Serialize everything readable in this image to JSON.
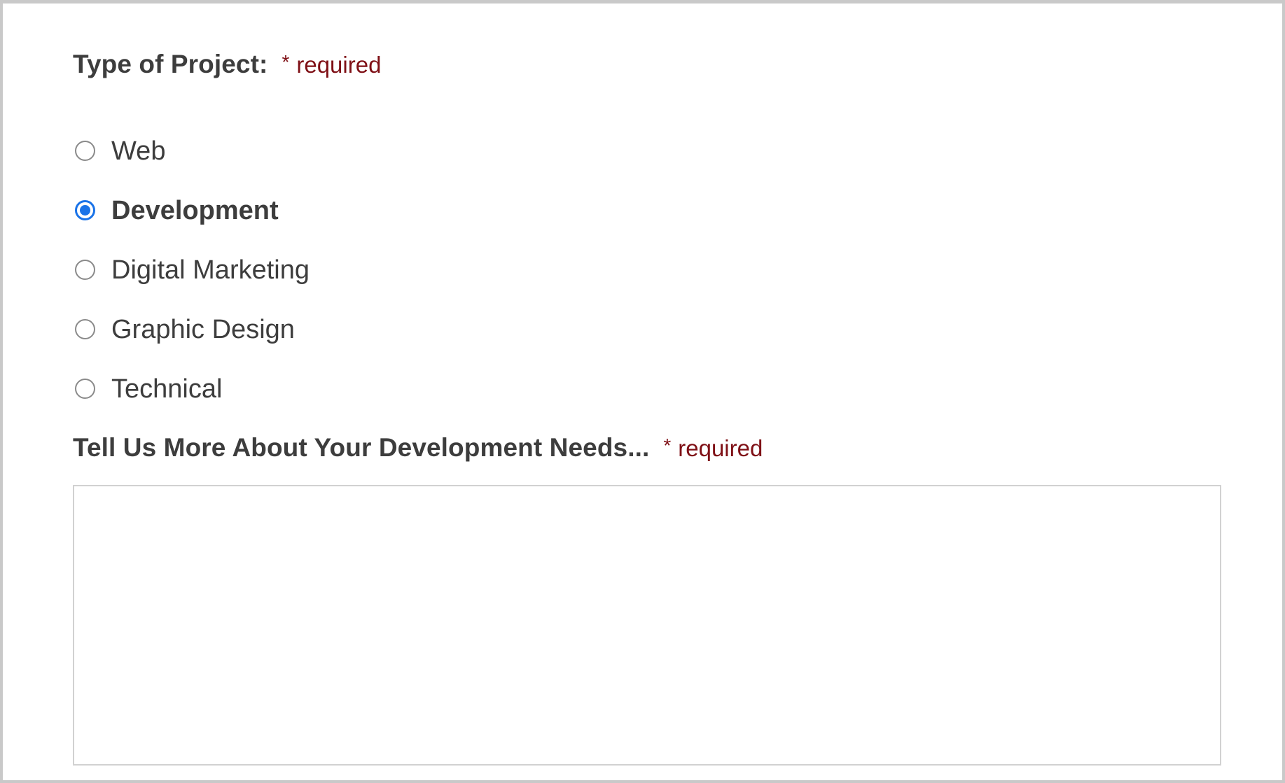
{
  "project_type": {
    "label": "Type of Project:",
    "required_star": "*",
    "required_text": "required",
    "options": [
      {
        "label": "Web",
        "checked": false
      },
      {
        "label": "Development",
        "checked": true
      },
      {
        "label": "Digital Marketing",
        "checked": false
      },
      {
        "label": "Graphic Design",
        "checked": false
      },
      {
        "label": "Technical",
        "checked": false
      }
    ]
  },
  "details": {
    "label": "Tell Us More About Your Development Needs...",
    "required_star": "*",
    "required_text": "required",
    "value": "",
    "placeholder": ""
  },
  "colors": {
    "accent": "#1a73e8",
    "required": "#7f1016",
    "text": "#3d3d3d",
    "border": "#c9c9c9"
  }
}
